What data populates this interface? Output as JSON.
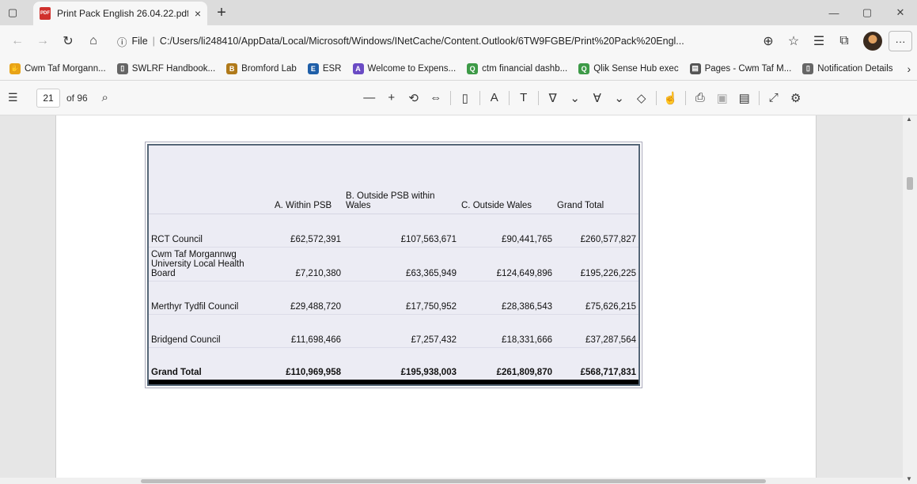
{
  "tab": {
    "title": "Print Pack English 26.04.22.pdf",
    "close": "×",
    "new_tab": "+"
  },
  "window": {
    "minimize": "—",
    "restore": "▢",
    "close": "✕"
  },
  "address": {
    "file_label": "File",
    "url": "C:/Users/li248410/AppData/Local/Microsoft/Windows/INetCache/Content.Outlook/6TW9FGBE/Print%20Pack%20Engl...",
    "more": "···"
  },
  "favorites": [
    {
      "label": "Cwm Taf Morgann...",
      "icon": "hand-icon",
      "color": "#e8a317"
    },
    {
      "label": "SWLRF Handbook...",
      "icon": "page-icon",
      "color": "#666666"
    },
    {
      "label": "Bromford Lab",
      "icon": "bromford-icon",
      "color": "#b07a1a"
    },
    {
      "label": "ESR",
      "icon": "esr-icon",
      "color": "#1f5fa8"
    },
    {
      "label": "Welcome to Expens...",
      "icon": "expenses-icon",
      "color": "#6a4bc4"
    },
    {
      "label": "ctm financial dashb...",
      "icon": "qlik-icon",
      "color": "#3d9a47"
    },
    {
      "label": "Qlik Sense Hub exec",
      "icon": "qlik-icon",
      "color": "#3d9a47"
    },
    {
      "label": "Pages - Cwm Taf M...",
      "icon": "pages-icon",
      "color": "#555555"
    },
    {
      "label": "Notification Details",
      "icon": "page-icon",
      "color": "#666666"
    }
  ],
  "pdf_toolbar": {
    "page_current": "21",
    "page_total": "of 96"
  },
  "table": {
    "headers": [
      "",
      "A. Within PSB",
      "B. Outside PSB within Wales",
      "C. Outside Wales",
      "Grand Total"
    ],
    "rows": [
      {
        "name": "RCT Council",
        "a": "£62,572,391",
        "b": "£107,563,671",
        "c": "£90,441,765",
        "total": "£260,577,827"
      },
      {
        "name": "Cwm Taf Morgannwg University Local Health Board",
        "a": "£7,210,380",
        "b": "£63,365,949",
        "c": "£124,649,896",
        "total": "£195,226,225"
      },
      {
        "name": "Merthyr Tydfil Council",
        "a": "£29,488,720",
        "b": "£17,750,952",
        "c": "£28,386,543",
        "total": "£75,626,215"
      },
      {
        "name": "Bridgend Council",
        "a": "£11,698,466",
        "b": "£7,257,432",
        "c": "£18,331,666",
        "total": "£37,287,564"
      }
    ],
    "grand_total": {
      "name": "Grand Total",
      "a": "£110,969,958",
      "b": "£195,938,003",
      "c": "£261,809,870",
      "total": "£568,717,831"
    }
  }
}
